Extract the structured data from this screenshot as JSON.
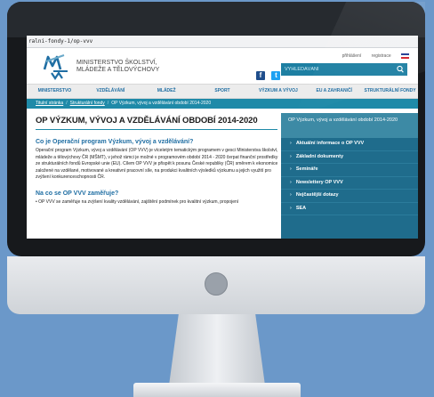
{
  "browser": {
    "url": "ralni-fondy-1/op-vvv"
  },
  "header": {
    "ministry_line1": "MINISTERSTVO ŠKOLSTVÍ,",
    "ministry_line2": "MLÁDEŽE A TĚLOVÝCHOVY",
    "login": "přihlášení",
    "register": "registrace",
    "search_placeholder": "VYHLEDÁVÁNÍ"
  },
  "nav": [
    "MINISTERSTVO",
    "VZDĚLÁVÁNÍ",
    "MLÁDEŽ",
    "SPORT",
    "VÝZKUM A VÝVOJ",
    "EU A ZAHRANIČÍ",
    "STRUKTURÁLNÍ FONDY"
  ],
  "breadcrumb": {
    "home": "Titulní stránka",
    "section": "Strukturální fondy",
    "current": "OP Výzkum, vývoj a vzdělávání období 2014-2020"
  },
  "main": {
    "title": "OP VÝZKUM, VÝVOJ A VZDĚLÁVÁNÍ OBDOBÍ 2014-2020",
    "q1": "Co je Operační program Výzkum, vývoj a vzdělávání?",
    "p1": "Operační program Výzkum, vývoj a vzdělávání (OP VVV) je víceletým tematickým programem v gesci Ministerstva školství, mládeže a tělovýchovy ČR (MŠMT), v jehož rámci je možné v programovém období 2014 - 2020 čerpat finanční prostředky ze strukturálních fondů Evropské unie (EU). Cílem OP VVV je přispět k posunu České republiky (ČR) směrem k ekonomice založené na vzdělané, motivované a kreativní pracovní síle, na produkci kvalitních výsledků výzkumu a jejich využití pro zvýšení konkurenceschopnosti ČR.",
    "q2": "Na co se OP VVV zaměřuje?",
    "p2": "• OP VVV se zaměřuje na zvýšení kvality vzdělávání, zajištění podmínek pro kvalitní výzkum, propojení"
  },
  "sidebar": {
    "header": "OP Výzkum, vývoj a vzdělávání období 2014-2020",
    "items": [
      "Aktuální informace o OP VVV",
      "Základní dokumenty",
      "Semináře",
      "Newslettery OP VVV",
      "Nejčastější dotazy",
      "SEA"
    ]
  },
  "colors": {
    "accent": "#1f8aa8",
    "nav_text": "#1f6ea3",
    "sidebar_bg": "#1f6c8c",
    "background": "#6b98c9"
  }
}
